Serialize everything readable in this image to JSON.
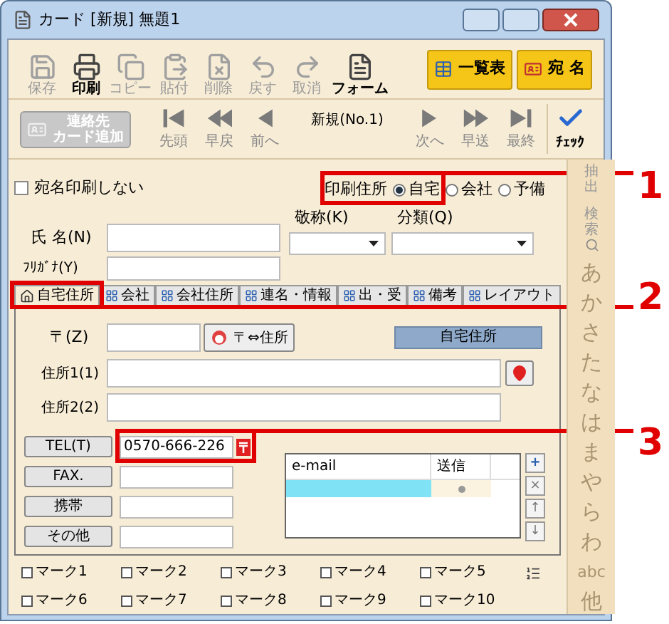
{
  "window": {
    "title": "カード  [新規]  無題1"
  },
  "toolbar": [
    {
      "label": "保存",
      "kind": "save",
      "disabled": true
    },
    {
      "label": "印刷",
      "kind": "print",
      "disabled": false
    },
    {
      "label": "コピー",
      "kind": "copy",
      "disabled": true
    },
    {
      "label": "貼付",
      "kind": "paste",
      "disabled": true
    },
    {
      "label": "削除",
      "kind": "delete",
      "disabled": true
    },
    {
      "label": "戻す",
      "kind": "undo",
      "disabled": true
    },
    {
      "label": "取消",
      "kind": "redo",
      "disabled": true
    },
    {
      "label": "フォーム",
      "kind": "form",
      "disabled": false
    }
  ],
  "view_buttons": [
    {
      "label": "一覧表",
      "kind": "list"
    },
    {
      "label": "宛 名",
      "kind": "address"
    }
  ],
  "add_contact": {
    "lines": [
      "連絡先",
      "カード追加"
    ]
  },
  "navigation": {
    "back": [
      {
        "label": "先頭",
        "kind": "first"
      },
      {
        "label": "早戻",
        "kind": "rewind"
      },
      {
        "label": "前へ",
        "kind": "prev"
      }
    ],
    "record": "新規(No.1)",
    "forward": [
      {
        "label": "次へ",
        "kind": "next"
      },
      {
        "label": "早送",
        "kind": "forward"
      },
      {
        "label": "最終",
        "kind": "last"
      }
    ],
    "check": "ﾁｪｯｸ"
  },
  "no_print": {
    "label": "宛名印刷しない",
    "checked": false
  },
  "print_address": {
    "label": "印刷住所",
    "options": [
      {
        "label": "自宅",
        "selected": true
      },
      {
        "label": "会社",
        "selected": false
      },
      {
        "label": "予備",
        "selected": false
      }
    ]
  },
  "name": {
    "label": "氏  名(N)"
  },
  "honorific": {
    "label": "敬称(K)"
  },
  "category": {
    "label": "分類(Q)"
  },
  "furigana": {
    "label": "ﾌﾘｶﾞﾅ(Y)"
  },
  "tabs": [
    {
      "label": "自宅住所",
      "selected": true
    },
    {
      "label": "会社",
      "selected": false
    },
    {
      "label": "会社住所",
      "selected": false
    },
    {
      "label": "連名・情報",
      "selected": false
    },
    {
      "label": "出・受",
      "selected": false
    },
    {
      "label": "備考",
      "selected": false
    },
    {
      "label": "レイアウト",
      "selected": false
    }
  ],
  "postal": {
    "label": "〒(Z)",
    "button": "〒⇔住所",
    "section": "自宅住所"
  },
  "address_fields": [
    {
      "label": "住所1(1)",
      "map": true
    },
    {
      "label": "住所2(2)",
      "map": false
    }
  ],
  "phones": [
    {
      "label": "TEL(T)",
      "value": "0570-666-226"
    },
    {
      "label": "FAX."
    },
    {
      "label": "携帯"
    },
    {
      "label": "その他"
    }
  ],
  "email_table": {
    "columns": [
      "e-mail",
      "送信"
    ],
    "row_selected": true
  },
  "email_buttons": [
    "+",
    "×",
    "↑",
    "↓"
  ],
  "marks": [
    {
      "label": "マーク1",
      "checked": false
    },
    {
      "label": "マーク2",
      "checked": false
    },
    {
      "label": "マーク3",
      "checked": false
    },
    {
      "label": "マーク4",
      "checked": false
    },
    {
      "label": "マーク5",
      "checked": false
    },
    {
      "label": "マーク6",
      "checked": false
    },
    {
      "label": "マーク7",
      "checked": false
    },
    {
      "label": "マーク8",
      "checked": false
    },
    {
      "label": "マーク9",
      "checked": false
    },
    {
      "label": "マーク10",
      "checked": false
    }
  ],
  "side_index": {
    "extract": "抽出",
    "search": "検索",
    "letters": [
      "あ",
      "か",
      "さ",
      "た",
      "な",
      "は",
      "ま",
      "や",
      "ら",
      "わ",
      "abc",
      "他"
    ]
  },
  "callouts": [
    "1",
    "2",
    "3"
  ]
}
